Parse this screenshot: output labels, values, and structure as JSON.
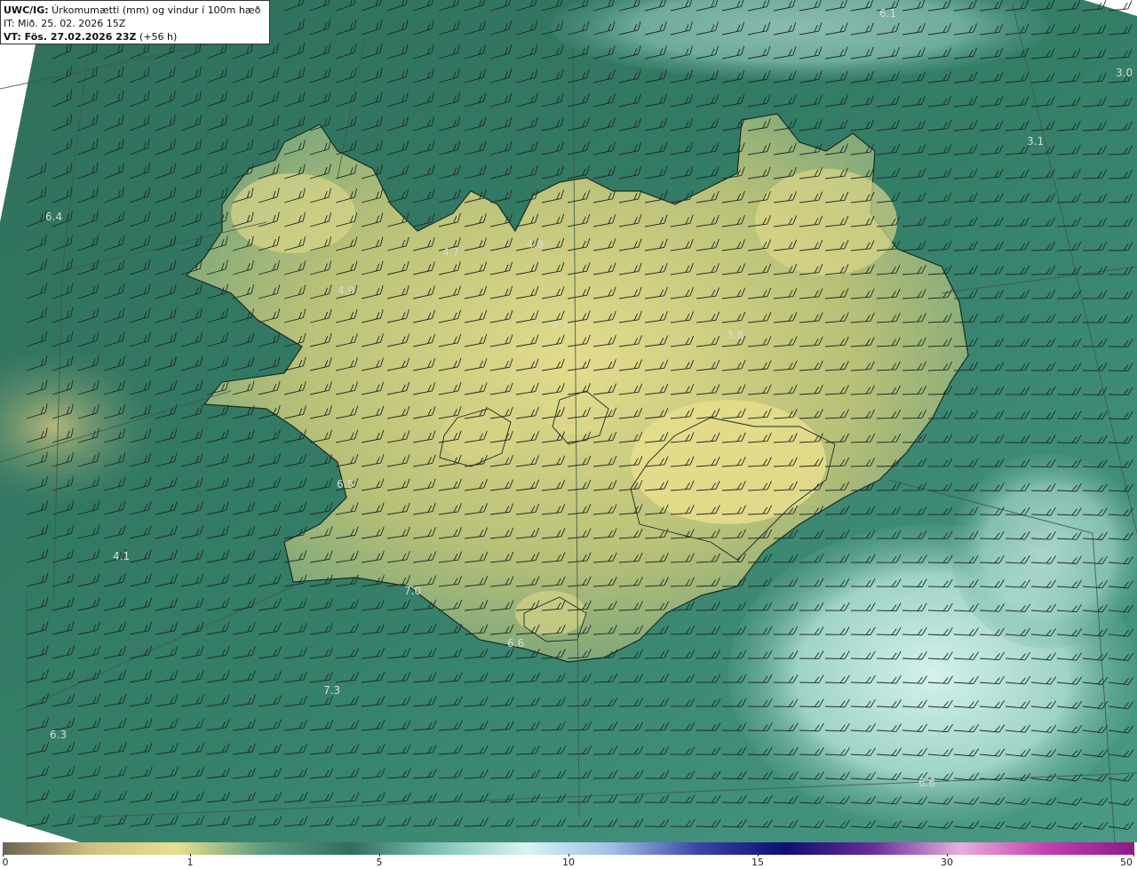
{
  "header": {
    "model": "UWC/IG:",
    "title": " Úrkomumætti (mm) og vindur í 100m hæð",
    "init_time": "IT: Mið. 25. 02. 2026 15Z",
    "valid_prefix": "VT: Fös. 27.02.2026 23Z",
    "valid_suffix": " (+56 h)"
  },
  "value_labels": [
    {
      "text": "6.1"
    },
    {
      "text": "3.0"
    },
    {
      "text": "3.1"
    },
    {
      "text": "6.4"
    },
    {
      "text": "4.7"
    },
    {
      "text": "4.8"
    },
    {
      "text": "4.9"
    },
    {
      "text": "4.7"
    },
    {
      "text": "3.8"
    },
    {
      "text": "6.5"
    },
    {
      "text": "4.1"
    },
    {
      "text": "7.0"
    },
    {
      "text": "6.6"
    },
    {
      "text": "7.3"
    },
    {
      "text": "6.3"
    },
    {
      "text": "6.6"
    }
  ],
  "colorbar": {
    "ticks": [
      "0",
      "1",
      "5",
      "10",
      "15",
      "30",
      "50"
    ],
    "colors": [
      "#6e6151",
      "#cfbf80",
      "#e8e08e",
      "#5a9b7e",
      "#2f6e5e",
      "#7fc2b7",
      "#d8f3f3",
      "#9fc0e6",
      "#3a44a8",
      "#0f0f70",
      "#6a2c9a",
      "#e6b0dc",
      "#c33fae",
      "#8c1a86"
    ]
  },
  "colors": {
    "ocean": "#2f7a66",
    "land": "#c9c67c",
    "land_high": "#e2db8a",
    "wet_sea": "#a7d8cf",
    "coast": "#1a2a22",
    "grid": "#3d5a4c",
    "barb": "#1e2a24"
  }
}
